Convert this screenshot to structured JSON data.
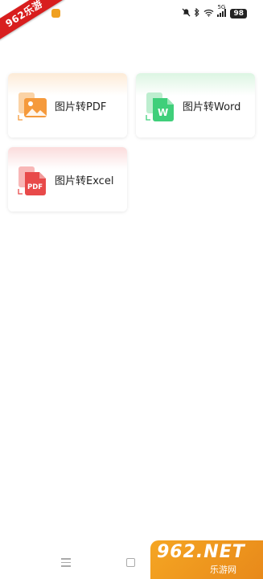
{
  "status_bar": {
    "watermark_text": "962乐游",
    "network": "5G",
    "battery": "98"
  },
  "cards": {
    "pdf": {
      "label": "图片转PDF",
      "icon": "image-to-pdf-icon",
      "color": "#f59a3c"
    },
    "word": {
      "label": "图片转Word",
      "icon": "image-to-word-icon",
      "color": "#3fcf7a"
    },
    "excel": {
      "label": "图片转Excel",
      "icon": "image-to-excel-icon",
      "color": "#e84a4a",
      "icon_text": "PDF"
    }
  },
  "watermark": {
    "logo": "962.NET",
    "caption": "乐游网"
  }
}
